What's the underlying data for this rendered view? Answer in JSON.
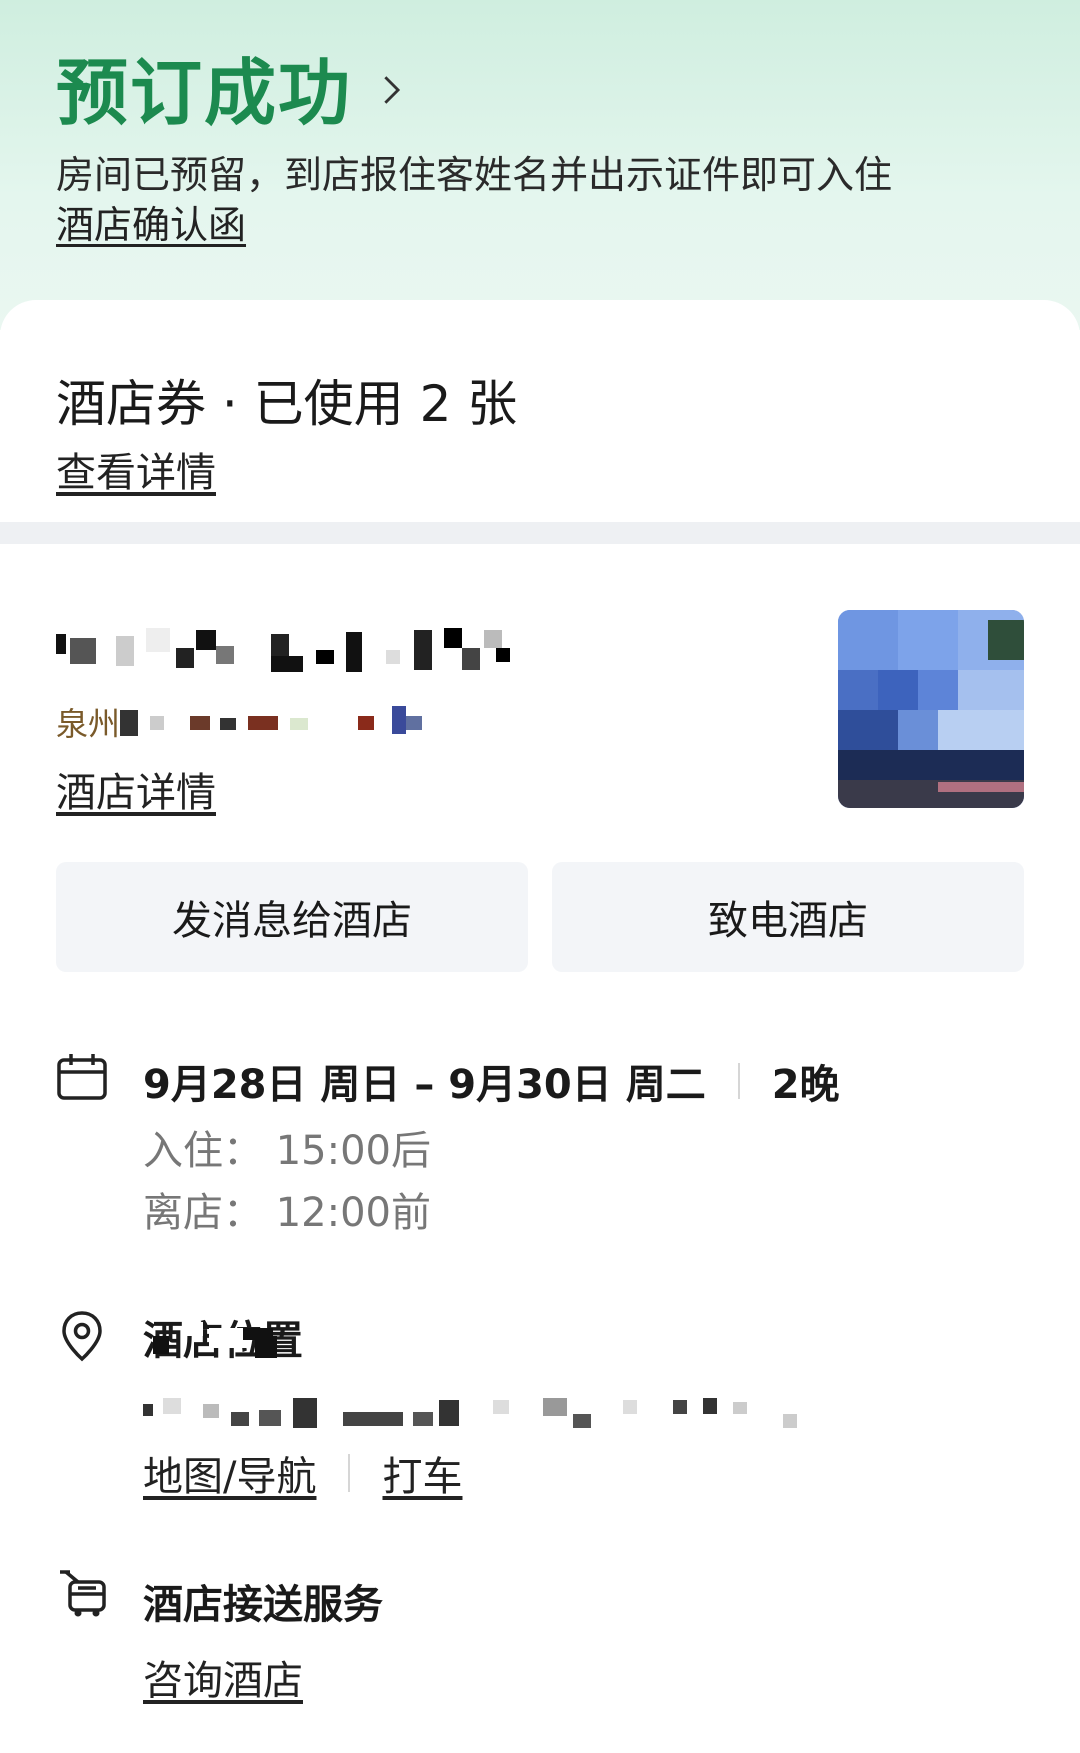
{
  "header": {
    "title": "预订成功",
    "subtitle": "房间已预留，到店报住客姓名并出示证件即可入住",
    "confirmation_link": "酒店确认函"
  },
  "voucher": {
    "title": "酒店券 · 已使用 2 张",
    "details_link": "查看详情"
  },
  "hotel": {
    "address_prefix": "泉州",
    "details_link": "酒店详情",
    "message_button": "发消息给酒店",
    "call_button": "致电酒店"
  },
  "stay": {
    "dates": "9月28日 周日 – 9月30日 周二",
    "nights": "2晚",
    "checkin": "入住：  15:00后",
    "checkout": "离店：  12:00前"
  },
  "location": {
    "title": "酒店位置",
    "map_link": "地图/导航",
    "taxi_link": "打车"
  },
  "shuttle": {
    "title": "酒店接送服务",
    "consult_link": "咨询酒店"
  },
  "colors": {
    "accent_green": "#1c8a4f",
    "header_bg": "#d9f2e6",
    "button_bg": "#f3f5f8"
  }
}
